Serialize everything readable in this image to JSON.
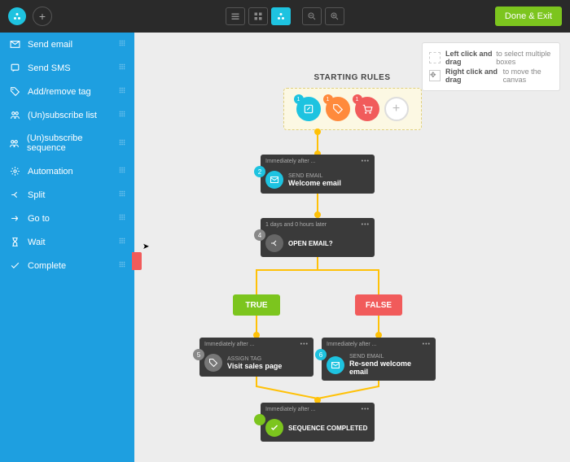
{
  "topbar": {
    "done_label": "Done & Exit"
  },
  "hints": {
    "left": "Left click and drag",
    "left_sub": "to select multiple boxes",
    "right": "Right click and drag",
    "right_sub": "to move the canvas"
  },
  "sidebar": {
    "items": [
      {
        "label": "Send email"
      },
      {
        "label": "Send SMS"
      },
      {
        "label": "Add/remove tag"
      },
      {
        "label": "(Un)subscribe list"
      },
      {
        "label": "(Un)subscribe sequence"
      },
      {
        "label": "Automation"
      },
      {
        "label": "Split"
      },
      {
        "label": "Go to"
      },
      {
        "label": "Wait"
      },
      {
        "label": "Complete"
      }
    ]
  },
  "start": {
    "title": "STARTING RULES",
    "badges": [
      "1",
      "1",
      "1"
    ]
  },
  "nodes": {
    "n2": {
      "num": "2",
      "hdr": "Immediately after ...",
      "type": "SEND EMAIL",
      "title": "Welcome email",
      "color": "#1ec3e0"
    },
    "n4": {
      "num": "4",
      "hdr": "1 days and 0 hours later",
      "type": "",
      "title": "OPEN EMAIL?",
      "color": "#666"
    },
    "n5": {
      "num": "5",
      "hdr": "Immediately after ...",
      "type": "ASSIGN TAG",
      "title": "Visit sales page",
      "color": "#777"
    },
    "n6": {
      "num": "6",
      "hdr": "Immediately after ...",
      "type": "SEND EMAIL",
      "title": "Re-send welcome email",
      "color": "#1ec3e0"
    },
    "n7": {
      "num": "",
      "hdr": "Immediately after ...",
      "type": "",
      "title": "SEQUENCE COMPLETED",
      "color": "#7cc51e"
    }
  },
  "cond": {
    "true": "TRUE",
    "false": "FALSE"
  }
}
